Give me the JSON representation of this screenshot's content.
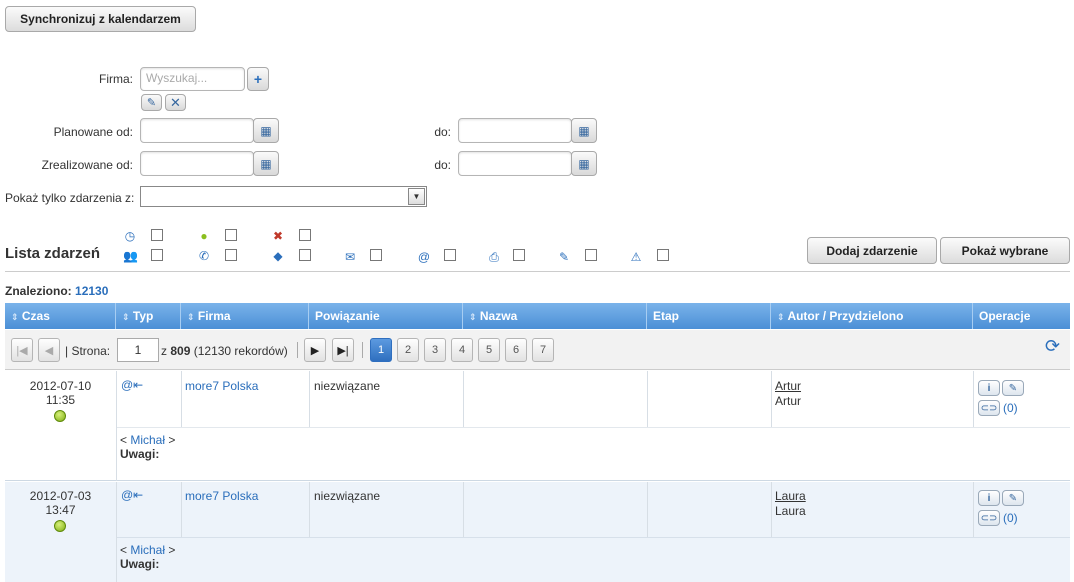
{
  "sync_button": "Synchronizuj z kalendarzem",
  "filters": {
    "firma_label": "Firma:",
    "firma_placeholder": "Wyszukaj...",
    "planowane_od_label": "Planowane od:",
    "zrealizowane_od_label": "Zrealizowane od:",
    "do_label": "do:",
    "pokaz_label": "Pokaż tylko zdarzenia z:"
  },
  "list_title": "Lista zdarzeń",
  "add_event_button": "Dodaj zdarzenie",
  "show_selected_button": "Pokaż wybrane",
  "found_label": "Znaleziono:",
  "found_count": "12130",
  "columns": [
    "Czas",
    "Typ",
    "Firma",
    "Powiązanie",
    "Nazwa",
    "Etap",
    "Autor / Przydzielono",
    "Operacje"
  ],
  "pager": {
    "page_label": "| Strona:",
    "current_page": "1",
    "of_text": "z",
    "total_pages": "809",
    "records_text": "(12130 rekordów)",
    "pages": [
      "1",
      "2",
      "3",
      "4",
      "5",
      "6",
      "7"
    ]
  },
  "events": [
    {
      "date": "2012-07-10",
      "time": "11:35",
      "company": "more7 Polska",
      "relation": "niezwiązane",
      "author": "Artur",
      "assigned": "Artur",
      "attachments": "(0)",
      "participant": "Michał",
      "remarks_label": "Uwagi:"
    },
    {
      "date": "2012-07-03",
      "time": "13:47",
      "company": "more7 Polska",
      "relation": "niezwiązane",
      "author": "Laura",
      "assigned": "Laura",
      "attachments": "(0)",
      "participant": "Michał",
      "remarks_label": "Uwagi:"
    }
  ],
  "colors": {
    "header_blue": "#4b8fd6",
    "link_blue": "#2a6ebb",
    "active_page": "#3a7cc6",
    "status_green": "#8bbf1f"
  }
}
